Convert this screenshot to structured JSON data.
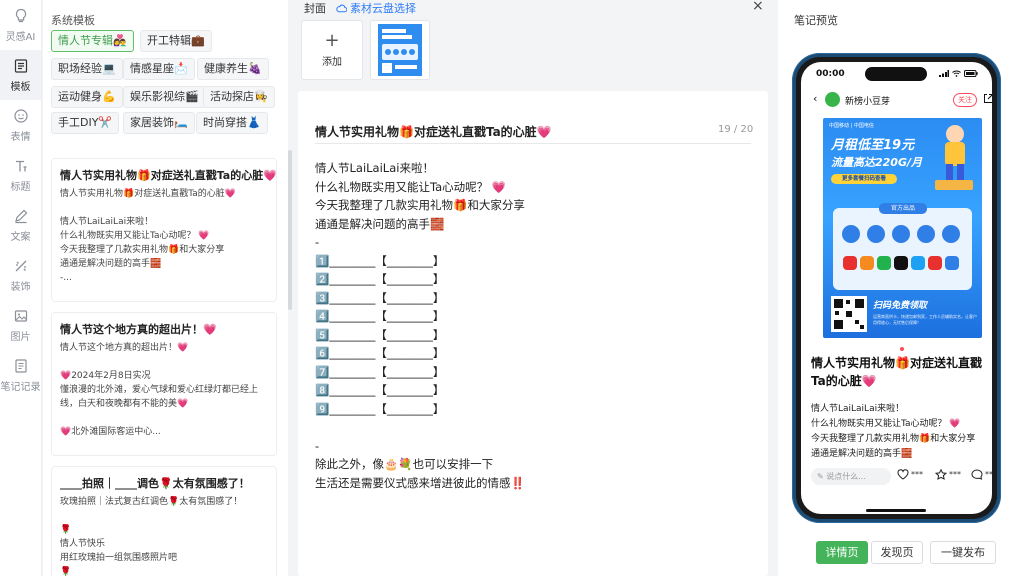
{
  "rail": [
    {
      "label": "灵感AI",
      "icon": "bulb-icon"
    },
    {
      "label": "模板",
      "icon": "template-icon"
    },
    {
      "label": "表情",
      "icon": "emoji-icon"
    },
    {
      "label": "标题",
      "icon": "title-icon"
    },
    {
      "label": "文案",
      "icon": "copywriting-icon"
    },
    {
      "label": "装饰",
      "icon": "decoration-icon"
    },
    {
      "label": "图片",
      "icon": "image-icon"
    },
    {
      "label": "笔记记录",
      "icon": "notes-record-icon"
    }
  ],
  "templates": {
    "title": "系统模板",
    "chips": [
      "情人节专辑👩‍❤️‍👨",
      "开工特辑💼",
      "职场经验💻",
      "情感星座📩",
      "健康养生🍇",
      "运动健身💪",
      "娱乐影视综🎬",
      "活动探店👩‍🍳",
      "手工DIY✂️",
      "家居装饰🛏️",
      "时尚穿搭👗"
    ],
    "cards": [
      {
        "title": "情人节实用礼物🎁对症送礼直戳Ta的心脏💗",
        "lines": [
          "情人节实用礼物🎁对症送礼直戳Ta的心脏💗",
          "",
          "情人节LaiLaiLai来啦！",
          "什么礼物既实用又能让Ta心动呢？ 💗",
          "今天我整理了几款实用礼物🎁和大家分享",
          "通通是解决问题的高手🧱",
          "-..."
        ]
      },
      {
        "title": "情人节这个地方真的超出片！💗",
        "lines": [
          "情人节这个地方真的超出片！💗",
          "",
          "💗2024年2月8日实况",
          "懂浪漫的北外滩，爱心气球和爱心红绿灯都已经上",
          "线，白天和夜晚都有不能的美💗",
          "",
          "💗北外滩国际客运中心..."
        ]
      },
      {
        "title": "____拍照｜____调色🌹太有氛围感了！",
        "lines": [
          "玫瑰拍照｜法式复古红调色🌹太有氛围感了！",
          "",
          "🌹",
          "情人节快乐",
          "用红玫瑰拍一组氛围感照片吧",
          "🌹"
        ]
      }
    ]
  },
  "cover": {
    "label": "封面",
    "cloud": "素材云盘选择",
    "add": "添加",
    "close": "×",
    "plus": "+"
  },
  "editor": {
    "title": "情人节实用礼物🎁对症送礼直戳Ta的心脏💗",
    "count": "19 / 20",
    "lines": [
      "情人节LaiLaiLai来啦！",
      "什么礼物既实用又能让Ta心动呢？ 💗",
      "今天我整理了几款实用礼物🎁和大家分享",
      "通通是解决问题的高手🧱",
      "-",
      "1️⃣________【________】",
      "2️⃣________【________】",
      "3️⃣________【________】",
      "4️⃣________【________】",
      "5️⃣________【________】",
      "6️⃣________【________】",
      "7️⃣________【________】",
      "8️⃣________【________】",
      "9️⃣________【________】",
      "",
      "-",
      "除此之外，像🎂💐也可以安排一下",
      "生活还是需要仪式感来增进彼此的情感‼️"
    ]
  },
  "preview": {
    "title": "笔记预览",
    "time": "00:00",
    "back": "‹",
    "account": "新榜小豆芽",
    "follow": "关注",
    "poster": {
      "brand": "中国移动 | 中国电信",
      "headline1": "月租低至19元",
      "headline2": "流量高达220G/月",
      "cta_top": "更多套餐扫码查看",
      "panel_title": "官方出品",
      "scan": "扫码免费领取",
      "small": "运营商直供卡，快递包邮到家，工作人员辅助实名，让客户用得放心，无忧售后保障！"
    },
    "note_title": "情人节实用礼物🎁对症送礼直戳Ta的心脏💗",
    "lines": [
      "情人节LaiLaiLai来啦！",
      "什么礼物既实用又能让Ta心动呢？ 💗",
      "今天我整理了几款实用礼物🎁和大家分享",
      "通通是解决问题的高手🧱"
    ],
    "comment_placeholder": "说点什么...",
    "like": "***",
    "fav": "***",
    "comment": "***"
  },
  "tabs": [
    "详情页",
    "发现页",
    "一键发布"
  ],
  "colors": {
    "accent": "#45b35a",
    "link": "#2f7cf6",
    "follow": "#ff4d5a"
  }
}
